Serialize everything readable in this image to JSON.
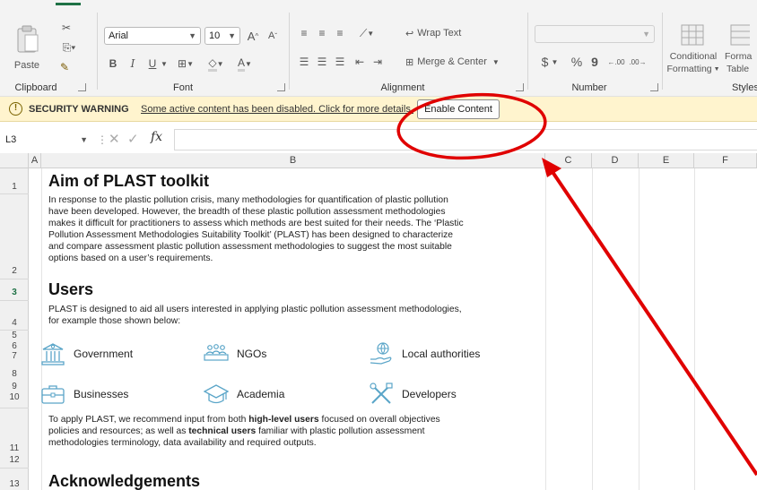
{
  "ribbon": {
    "clipboard": {
      "paste_label": "Paste",
      "group_label": "Clipboard"
    },
    "font": {
      "family": "Arial",
      "size": "10",
      "bold": "B",
      "italic": "I",
      "underline": "U",
      "grow": "A^",
      "shrink": "Aˇ",
      "font_color": "A",
      "group_label": "Font"
    },
    "alignment": {
      "wrap_text": "Wrap Text",
      "merge_center": "Merge & Center",
      "group_label": "Alignment"
    },
    "number": {
      "currency": "$",
      "percent": "%",
      "comma": "9",
      "inc_decimal": ".00",
      "dec_decimal": ".00",
      "group_label": "Number"
    },
    "styles": {
      "conditional": "Conditional",
      "formatting": "Formatting",
      "format_as": "Forma",
      "table": "Table",
      "group_label": "Styles"
    }
  },
  "security_bar": {
    "title": "SECURITY WARNING",
    "message": "Some active content has been disabled. Click for more details.",
    "button": "Enable Content"
  },
  "formula_bar": {
    "name_box": "L3",
    "fx": "fx",
    "content": ""
  },
  "columns": [
    "A",
    "B",
    "C",
    "D",
    "E",
    "F"
  ],
  "rows": [
    "1",
    "2",
    "3",
    "4",
    "5",
    "6",
    "7",
    "8",
    "9",
    "10",
    "11",
    "12",
    "13"
  ],
  "sheet": {
    "aim_title": "Aim of PLAST toolkit",
    "aim_lines": [
      "In response to the plastic pollution crisis, many methodologies for quantification of plastic pollution",
      "have been developed. However, the breadth of these plastic pollution assessment methodologies",
      "makes it difficult for practitioners to assess which methods are best suited for their needs. The ‘Plastic",
      "Pollution Assessment Methodologies Suitability Toolkit’ (PLAST) has been designed to characterize",
      "and compare assessment plastic pollution assessment methodologies to suggest the most suitable",
      "options based on a user’s requirements."
    ],
    "users_title": "Users",
    "users_lines": [
      "PLAST is designed to aid all users interested in applying plastic pollution assessment methodologies,",
      "for example those shown below:"
    ],
    "user_types": [
      "Government",
      "NGOs",
      "Local authorities",
      "Businesses",
      "Academia",
      "Developers"
    ],
    "apply_pre": "To apply PLAST, we recommend input from both ",
    "apply_bold1": "high-level users",
    "apply_mid1": " focused on overall objectives",
    "apply_line2_pre": "policies and resources; as well as ",
    "apply_bold2": "technical users",
    "apply_line2_post": " familiar with plastic pollution assessment",
    "apply_line3": "methodologies terminology, data availability and required outputs.",
    "ack_title": "Acknowledgements"
  },
  "colors": {
    "accent": "#1e7145",
    "icon_blue": "#5aa5c8",
    "annotation_red": "#e00000",
    "warning_bg": "#fff4ce"
  }
}
